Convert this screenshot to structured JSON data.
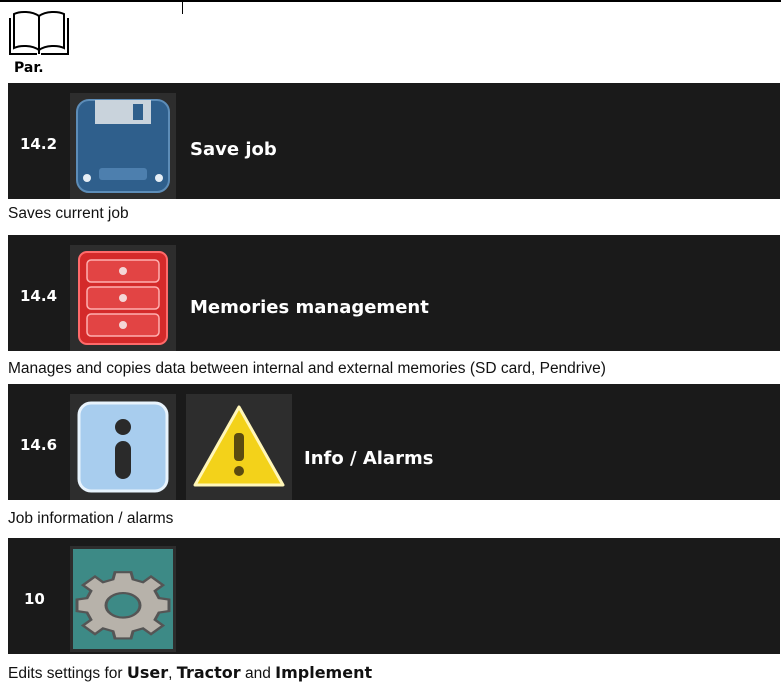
{
  "header": {
    "manual_icon": "open-book-icon",
    "par_label": "Par."
  },
  "rows": [
    {
      "par": "14.2",
      "icons": [
        "floppy-disk-save-icon"
      ],
      "title": "Save job",
      "description": "Saves current job"
    },
    {
      "par": "14.4",
      "icons": [
        "memory-drawers-icon"
      ],
      "title": "Memories management",
      "description": "Manages and copies data between internal and external memories (SD card, Pendrive)"
    },
    {
      "par": "14.6",
      "icons": [
        "info-icon",
        "warning-icon"
      ],
      "title": "Info / Alarms",
      "description": "Job information / alarms"
    },
    {
      "par": "10",
      "icons": [
        "gear-settings-icon"
      ],
      "title": "",
      "description": {
        "prefix": "Edits settings for ",
        "user": "User",
        "sep1": ", ",
        "tractor": "Tractor",
        "sep2": " and ",
        "implement": "Implement"
      }
    }
  ],
  "colors": {
    "row_background": "#1a1a1a",
    "tile_background": "#2d2d2d",
    "floppy_blue": "#2f5f8c",
    "memory_red": "#d42a2a",
    "info_blue": "#a8cdee",
    "warning_yellow": "#f3d21a",
    "gear_teal": "#3d8a86"
  }
}
